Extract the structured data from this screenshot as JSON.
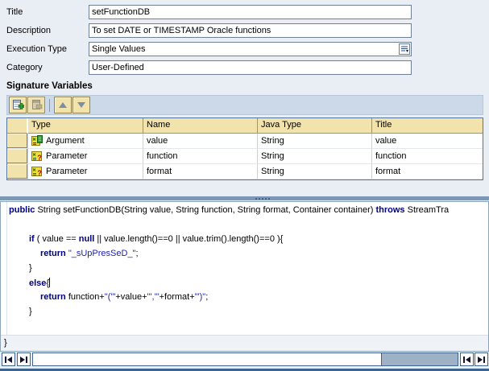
{
  "form": {
    "fields": [
      {
        "label": "Title",
        "value": "setFunctionDB"
      },
      {
        "label": "Description",
        "value": "To set DATE or TIMESTAMP Oracle functions"
      },
      {
        "label": "Execution Type",
        "value": "Single Values"
      },
      {
        "label": "Category",
        "value": "User-Defined"
      }
    ]
  },
  "signature": {
    "title": "Signature Variables",
    "toolbar": {
      "icons": [
        "add-variable-icon",
        "delete-variable-icon",
        "move-up-icon",
        "move-down-icon"
      ]
    },
    "table": {
      "columns": [
        "Type",
        "Name",
        "Java Type",
        "Title"
      ],
      "rows": [
        {
          "icon": "argument-icon",
          "type": "Argument",
          "name": "value",
          "java_type": "String",
          "title": "value"
        },
        {
          "icon": "parameter-icon",
          "type": "Parameter",
          "name": "function",
          "java_type": "String",
          "title": "function"
        },
        {
          "icon": "parameter-icon",
          "type": "Parameter",
          "name": "format",
          "java_type": "String",
          "title": "format"
        }
      ]
    }
  },
  "code": {
    "sig": {
      "k1": "public",
      "p1": " String setFunctionDB(String value, String function, String format, Container container) ",
      "k2": "throws",
      "p2": " StreamTra"
    },
    "l_if": {
      "k1": "if",
      "p1": " ( value == ",
      "k2": "null",
      "p2": " || value.length()==0 || value.trim().length()==0 ){"
    },
    "l_ret1": {
      "k1": "return",
      "p1": " ",
      "s1": "\"_sUpPresSeD_\"",
      "p2": ";"
    },
    "l_cb1": {
      "p1": "}"
    },
    "l_else": {
      "k1": "else",
      "p1": "{"
    },
    "l_ret2": {
      "k1": "return",
      "p1": " function+",
      "s1": "\"('\"",
      "p2": "+value+",
      "s2": "\"','\"",
      "p3": "+format+",
      "s3": "\"')\"",
      "p4": ";"
    },
    "l_cb2": {
      "p1": "}"
    },
    "closing": "}"
  },
  "colors": {
    "page_background": "#E9EDF4",
    "table_header_bg": "#F2E3AC",
    "toolbar_strip_bg": "#CBD9E8",
    "keyword": "#000080",
    "string_literal": "#2222AA",
    "splitter": "#7D97B6",
    "scrollbar_thumb": "#9FB2C5"
  }
}
